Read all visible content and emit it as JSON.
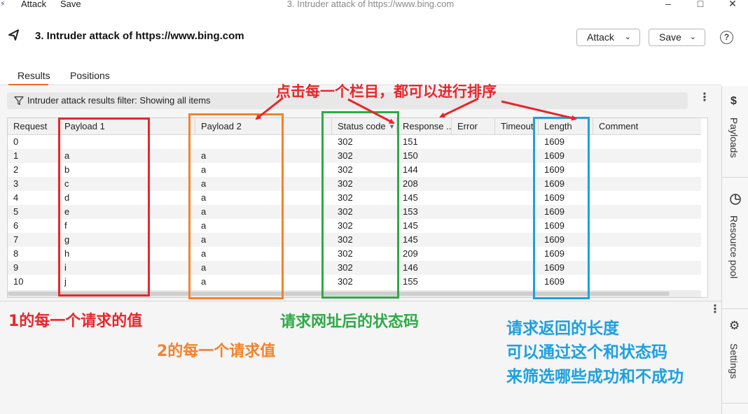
{
  "os_bar": {
    "menu": [
      "Attack",
      "Save"
    ],
    "title": "3. Intruder attack of https://www.bing.com"
  },
  "header": {
    "title": "3. Intruder attack of https://www.bing.com",
    "attack_label": "Attack",
    "save_label": "Save",
    "help_label": "?"
  },
  "tabs": [
    "Results",
    "Positions"
  ],
  "filter": {
    "text": "Intruder attack results filter: Showing all items"
  },
  "table": {
    "columns": [
      "Request",
      "Payload 1",
      "Payload 2",
      "Status code",
      "Response ...",
      "Error",
      "Timeout",
      "Length",
      "Comment"
    ],
    "rows": [
      [
        "0",
        "",
        "",
        "302",
        "151",
        "",
        "",
        "1609",
        ""
      ],
      [
        "1",
        "a",
        "a",
        "302",
        "150",
        "",
        "",
        "1609",
        ""
      ],
      [
        "2",
        "b",
        "a",
        "302",
        "144",
        "",
        "",
        "1609",
        ""
      ],
      [
        "3",
        "c",
        "a",
        "302",
        "208",
        "",
        "",
        "1609",
        ""
      ],
      [
        "4",
        "d",
        "a",
        "302",
        "145",
        "",
        "",
        "1609",
        ""
      ],
      [
        "5",
        "e",
        "a",
        "302",
        "153",
        "",
        "",
        "1609",
        ""
      ],
      [
        "6",
        "f",
        "a",
        "302",
        "145",
        "",
        "",
        "1609",
        ""
      ],
      [
        "7",
        "g",
        "a",
        "302",
        "145",
        "",
        "",
        "1609",
        ""
      ],
      [
        "8",
        "h",
        "a",
        "302",
        "209",
        "",
        "",
        "1609",
        ""
      ],
      [
        "9",
        "i",
        "a",
        "302",
        "146",
        "",
        "",
        "1609",
        ""
      ],
      [
        "10",
        "j",
        "a",
        "302",
        "155",
        "",
        "",
        "1609",
        ""
      ]
    ]
  },
  "side_panel": [
    "Payloads",
    "Resource pool",
    "Settings"
  ],
  "annotations": {
    "sort_hint": "点击每一个栏目，都可以进行排序",
    "payload1_note": "1的每一个请求的值",
    "payload2_note": "2的每一个请求值",
    "status_note": "请求网址后的状态码",
    "length_note_1": "请求返回的长度",
    "length_note_2": "可以通过这个和状态码",
    "length_note_3": "来筛选哪些成功和不成功"
  },
  "colors": {
    "red": "#e8262b",
    "orange": "#f5822a",
    "green": "#2eaa48",
    "blue": "#1da0e0",
    "accent": "#f26722"
  }
}
